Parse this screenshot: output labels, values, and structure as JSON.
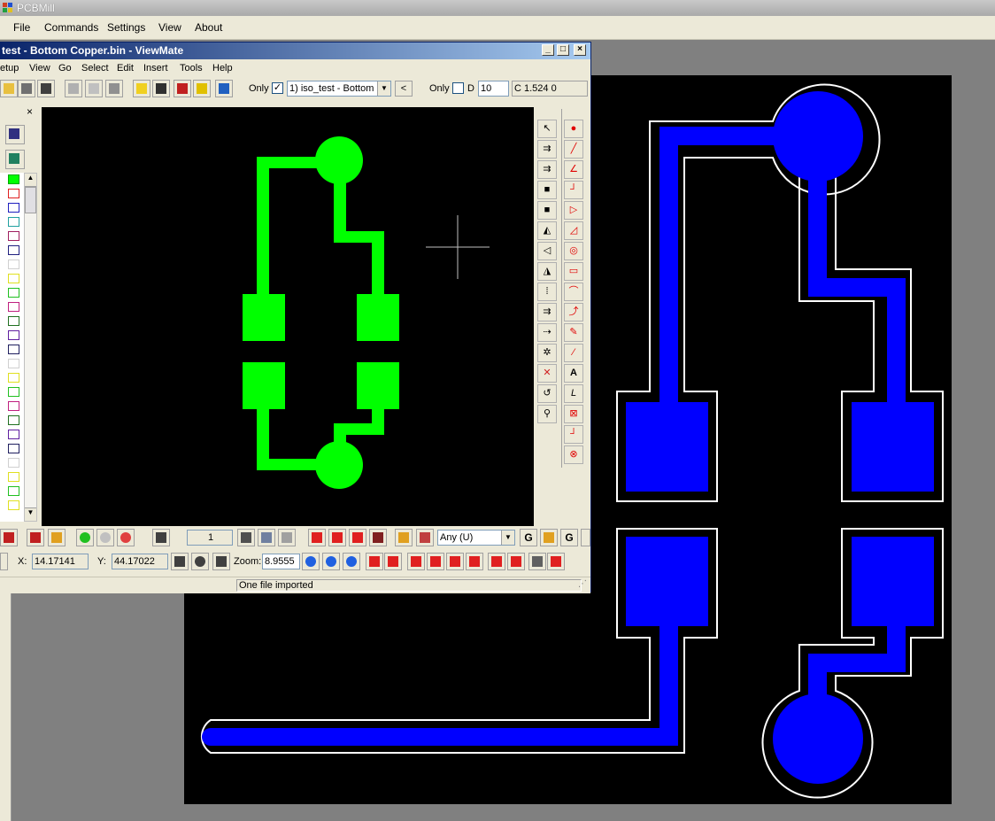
{
  "app": {
    "title": "PCBMill",
    "menu": [
      "File",
      "Commands",
      "Settings",
      "View",
      "About"
    ]
  },
  "viewer": {
    "title": "test - Bottom Copper.bin - ViewMate",
    "menu": [
      "etup",
      "View",
      "Go",
      "Select",
      "Edit",
      "Insert",
      "Tools",
      "Help"
    ],
    "toolbar": {
      "only_label_1": "Only",
      "only_checked_1": true,
      "layer_select": "1) iso_test - Bottom",
      "back_arrow": "<",
      "only_label_2": "Only",
      "only_checked_2": false,
      "d_label": "D",
      "d_value": "10",
      "aperture_text": "C 1.524  0"
    },
    "bottom_toolbar": {
      "layer_number": "1",
      "filter_select": "Any     (U)",
      "x_label": "X:",
      "x_value": "14.17141",
      "y_label": "Y:",
      "y_value": "44.17022",
      "zoom_label": "Zoom:",
      "zoom_value": "8.9555"
    },
    "status_text": "One file imported",
    "layer_panel_close": "×",
    "right_tools": [
      "A",
      "L"
    ]
  },
  "colors": {
    "viewer_trace": "#00ff00",
    "board_trace": "#0000ff",
    "board_bg": "#000000",
    "isolation_outline": "#ffffff",
    "title_blue": "#0a246a"
  }
}
